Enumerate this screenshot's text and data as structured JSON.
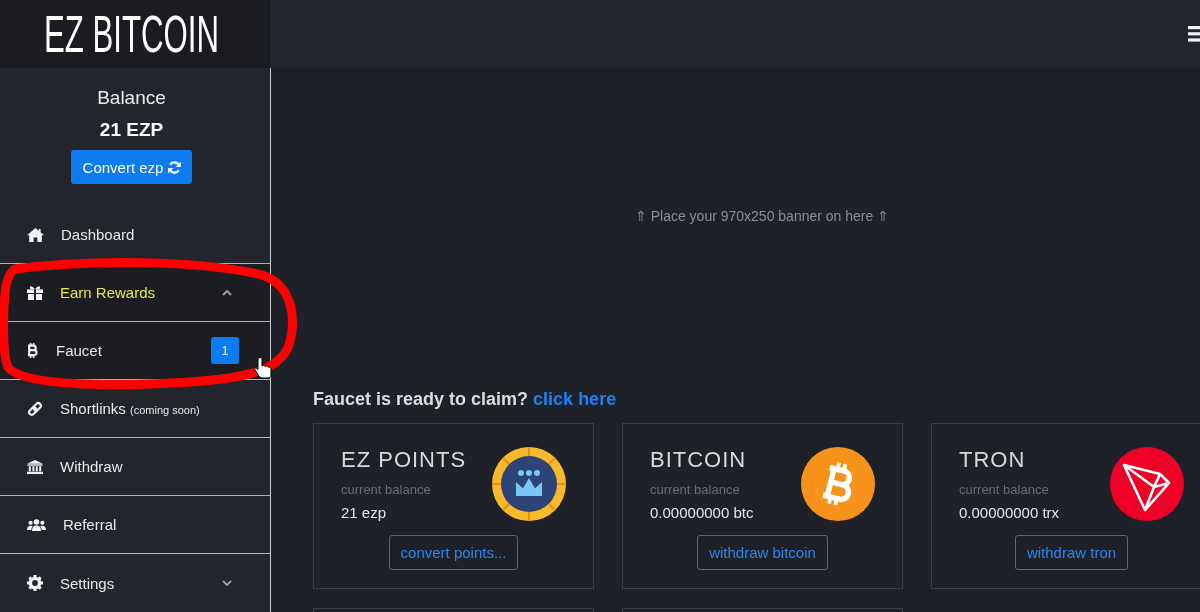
{
  "header": {
    "logo": "EZ BITCOIN"
  },
  "sidebar": {
    "balance_label": "Balance",
    "balance": "21 EZP",
    "convert_button": "Convert ezp",
    "items": [
      {
        "kind": "link",
        "label": "Dashboard",
        "selected": false
      },
      {
        "kind": "group",
        "label": "Earn Rewards",
        "selected": true,
        "expanded": true,
        "children": [
          {
            "label": "Faucet",
            "selected": false,
            "badge": "1"
          }
        ]
      },
      {
        "kind": "link",
        "label": "Shortlinks",
        "note": "(coming soon)",
        "selected": false
      },
      {
        "kind": "link",
        "label": "Withdraw",
        "selected": false
      },
      {
        "kind": "link",
        "label": "Referral",
        "selected": false
      },
      {
        "kind": "group",
        "label": "Settings",
        "selected": false,
        "expanded": false
      }
    ]
  },
  "main": {
    "banner_placeholder": "⇑ Place your 970x250 banner on here ⇑",
    "claim_notice": {
      "text": "Faucet is ready to claim?",
      "link": "click here"
    },
    "cards": [
      {
        "title": "EZ POINTS",
        "caption": "current balance",
        "amount": "21 ezp",
        "button": "convert points..."
      },
      {
        "title": "BITCOIN",
        "caption": "current balance",
        "amount": "0.00000000 btc",
        "button": "withdraw bitcoin"
      },
      {
        "title": "TRON",
        "caption": "current balance",
        "amount": "0.00000000 trx",
        "button": "withdraw tron"
      }
    ]
  }
}
